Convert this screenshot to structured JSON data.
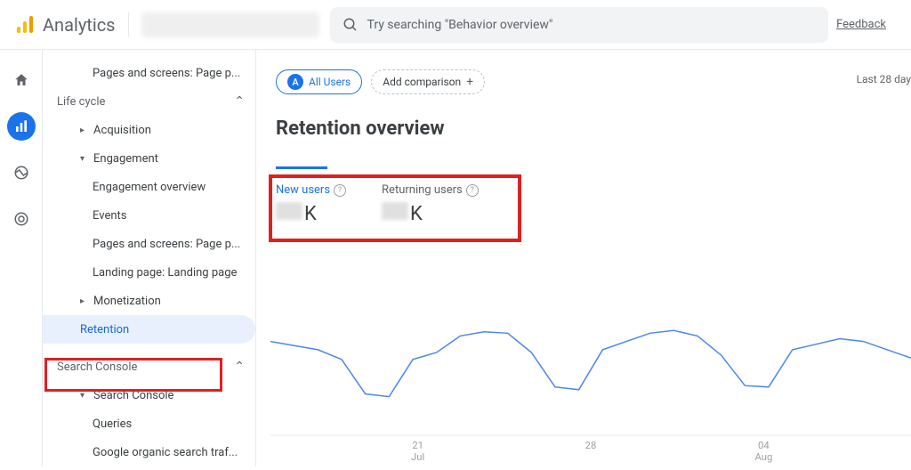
{
  "header": {
    "product_name": "Analytics",
    "search_placeholder": "Try searching \"Behavior overview\"",
    "feedback_label": "Feedback"
  },
  "rail": {
    "items": [
      "home",
      "reports",
      "explore",
      "advertising"
    ]
  },
  "sidebar": {
    "top_item": "Pages and screens: Page p...",
    "section_lifecycle": "Life cycle",
    "acquisition": "Acquisition",
    "engagement": "Engagement",
    "engagement_children": {
      "overview": "Engagement overview",
      "events": "Events",
      "pages": "Pages and screens: Page p...",
      "landing": "Landing page: Landing page"
    },
    "monetization": "Monetization",
    "retention": "Retention",
    "section_search_console": "Search Console",
    "search_console": "Search Console",
    "search_console_children": {
      "queries": "Queries",
      "organic": "Google organic search traf..."
    }
  },
  "chips": {
    "all_users_label": "All Users",
    "all_users_avatar": "A",
    "add_comparison_label": "Add comparison"
  },
  "date_range": "Last 28 day",
  "page_title": "Retention overview",
  "metrics": {
    "new_users_label": "New users",
    "new_users_value_suffix": "K",
    "returning_users_label": "Returning users",
    "returning_users_value_suffix": "K"
  },
  "chart_data": {
    "type": "line",
    "title": "",
    "xlabel": "",
    "ylabel": "",
    "ylim": [
      0,
      100
    ],
    "x_ticks": [
      {
        "top": "21",
        "bottom": "Jul"
      },
      {
        "top": "28",
        "bottom": ""
      },
      {
        "top": "04",
        "bottom": "Aug"
      }
    ],
    "series": [
      {
        "name": "New users",
        "color": "#1a73e8",
        "x": [
          0,
          1,
          2,
          3,
          4,
          5,
          6,
          7,
          8,
          9,
          10,
          11,
          12,
          13,
          14,
          15,
          16,
          17,
          18,
          19,
          20,
          21,
          22,
          23,
          24,
          25,
          26,
          27
        ],
        "values": [
          68,
          65,
          62,
          55,
          30,
          28,
          55,
          60,
          72,
          75,
          74,
          60,
          35,
          33,
          62,
          68,
          74,
          76,
          72,
          58,
          36,
          35,
          62,
          66,
          70,
          68,
          62,
          56
        ]
      },
      {
        "name": "Returning users",
        "color": "#1a73e8",
        "x": [],
        "values": []
      }
    ]
  }
}
